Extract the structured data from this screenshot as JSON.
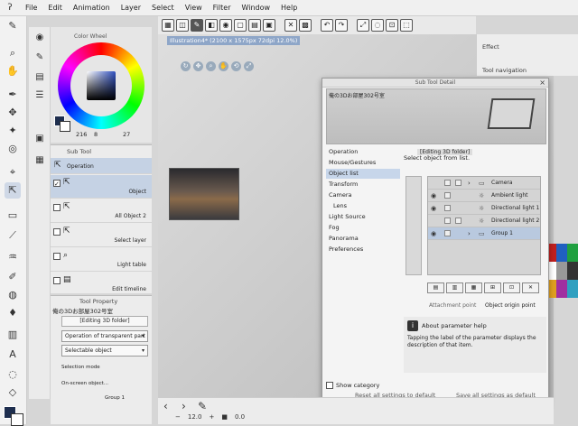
{
  "menu": {
    "logo": "ʔ",
    "items": [
      "File",
      "Edit",
      "Animation",
      "Layer",
      "Select",
      "View",
      "Filter",
      "Window",
      "Help"
    ]
  },
  "color_panel": {
    "title": "Color Wheel",
    "h": "216",
    "s": "8",
    "v": "27"
  },
  "sub_tool": {
    "title": "Sub Tool",
    "group": "Operation",
    "items": [
      {
        "label": "Object",
        "icon": "arrow-cursor-icon",
        "selected": true
      },
      {
        "label": "All Object 2",
        "icon": "arrow-cursor-icon",
        "selected": false
      },
      {
        "label": "Select layer",
        "icon": "layer-cursor-icon",
        "selected": false
      },
      {
        "label": "Light table",
        "icon": "magnifier-icon",
        "selected": false
      },
      {
        "label": "Edit timeline",
        "icon": "timeline-icon",
        "selected": false
      }
    ]
  },
  "tool_property": {
    "title": "Tool Property",
    "name": "俺の3Dお部屋302号室",
    "editing": "[Editing 3D folder]",
    "dropdown1": "Operation of transparent part",
    "dropdown2": "Selectable object",
    "label_select_mode": "Selection mode",
    "label_on_screen": "On-screen object...",
    "group_item": "Group 1"
  },
  "canvas": {
    "info": "Illustration4* (2100 x 1575px 72dpi 12.0%)",
    "zoom": "12.0",
    "angle": "0.0"
  },
  "right_panel": {
    "effect": "Effect",
    "tool_navigation": "Tool navigation"
  },
  "dialog": {
    "title": "Sub Tool Detail",
    "preview_name": "俺の3Dお部屋302号室",
    "editing_label": "[Editing 3D folder]",
    "nav": [
      "Operation",
      "Mouse/Gestures",
      "Object list",
      "Transform",
      "Camera",
      "Lens",
      "Light Source",
      "Fog",
      "Panorama",
      "Preferences"
    ],
    "nav_selected": "Object list",
    "select_hint": "Select object from list.",
    "objects": [
      {
        "name": "Camera",
        "icon": "folder-icon",
        "selected": false,
        "visible": false
      },
      {
        "name": "Ambient light",
        "icon": "light-icon",
        "selected": false,
        "visible": true
      },
      {
        "name": "Directional light 1",
        "icon": "light-icon",
        "selected": false,
        "visible": true
      },
      {
        "name": "Directional light 2",
        "icon": "light-icon",
        "selected": false,
        "visible": false
      },
      {
        "name": "Group 1",
        "icon": "folder-icon",
        "selected": true,
        "visible": true
      }
    ],
    "attachment_point": "Attachment point",
    "origin_point": "Object origin point",
    "help_title": "About parameter help",
    "help_text": "Tapping the label of the parameter displays the description of that item.",
    "show_category": "Show category",
    "reset_all": "Reset all settings to default",
    "save_all": "Save all settings as default"
  },
  "colors": {
    "accent": "#8ea6c8",
    "selected_row": "#c7d6ea",
    "main_color": "#1e2e4e"
  }
}
